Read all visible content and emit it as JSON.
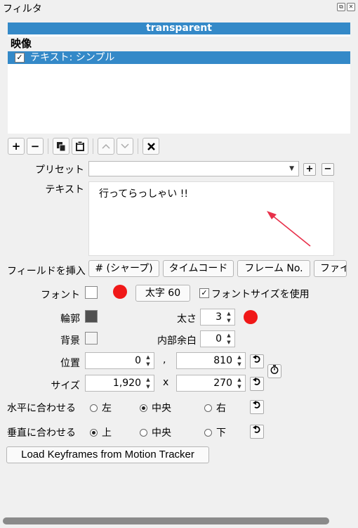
{
  "panel": {
    "title": "フィルタ"
  },
  "filter_list": {
    "header": "transparent",
    "section": "映像",
    "items": [
      {
        "label": "テキスト: シンプル",
        "checked": "✓"
      }
    ]
  },
  "toolbar": {
    "add": "+",
    "remove": "−",
    "copy": "⎘",
    "paste": "📋",
    "up": "︿",
    "down": "﹀",
    "deselect": "✕"
  },
  "preset": {
    "label": "プリセット",
    "value": "",
    "add": "+",
    "remove": "−"
  },
  "text": {
    "label": "テキスト",
    "value": "行ってらっしゃい !!"
  },
  "insert_field": {
    "label": "フィールドを挿入",
    "buttons": [
      "# (シャープ)",
      "タイムコード",
      "フレーム No.",
      "ファイ"
    ]
  },
  "font": {
    "label": "フォント",
    "font_button": "太字 60",
    "use_size_label": "フォントサイズを使用",
    "use_size_checked": "✓"
  },
  "outline": {
    "label": "輪郭",
    "color": "#505050",
    "thickness_label": "太さ",
    "thickness_value": "3"
  },
  "background": {
    "label": "背景",
    "padding_label": "内部余白",
    "padding_value": "0"
  },
  "position": {
    "label": "位置",
    "x": "0",
    "separator": ",",
    "y": "810"
  },
  "size": {
    "label": "サイズ",
    "w": "1,920",
    "separator": "x",
    "h": "270"
  },
  "halign": {
    "label": "水平に合わせる",
    "options": [
      "左",
      "中央",
      "右"
    ],
    "selected": "中央"
  },
  "valign": {
    "label": "垂直に合わせる",
    "options": [
      "上",
      "中央",
      "下"
    ],
    "selected": "上"
  },
  "keyframes_button": "Load Keyframes from Motion Tracker",
  "colors": {
    "accent": "#3489c8",
    "annotation": "#f01818"
  }
}
